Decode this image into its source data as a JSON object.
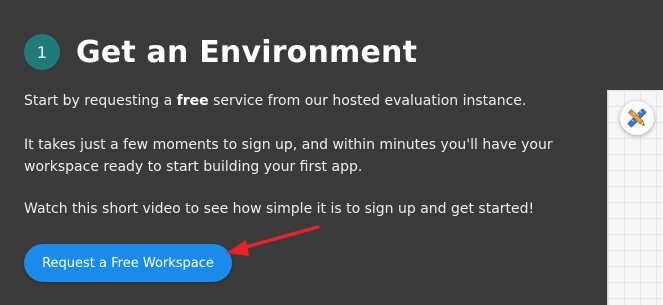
{
  "step": {
    "number": "1",
    "title": "Get an Environment"
  },
  "paragraphs": {
    "p1_before": "Start by requesting a ",
    "p1_bold": "free",
    "p1_after": " service from our hosted evaluation instance.",
    "p2": "It takes just a few moments to sign up, and within minutes you'll have your workspace ready to start building your first app.",
    "p3": "Watch this short video to see how simple it is to sign up and get started!"
  },
  "cta": {
    "label": "Request a Free Workspace"
  },
  "side": {
    "tool_icon": "pencil-ruler-icon"
  },
  "colors": {
    "background": "#3a3a3b",
    "badge": "#1f7a7a",
    "button": "#1a8bea",
    "arrow": "#e8202a"
  }
}
